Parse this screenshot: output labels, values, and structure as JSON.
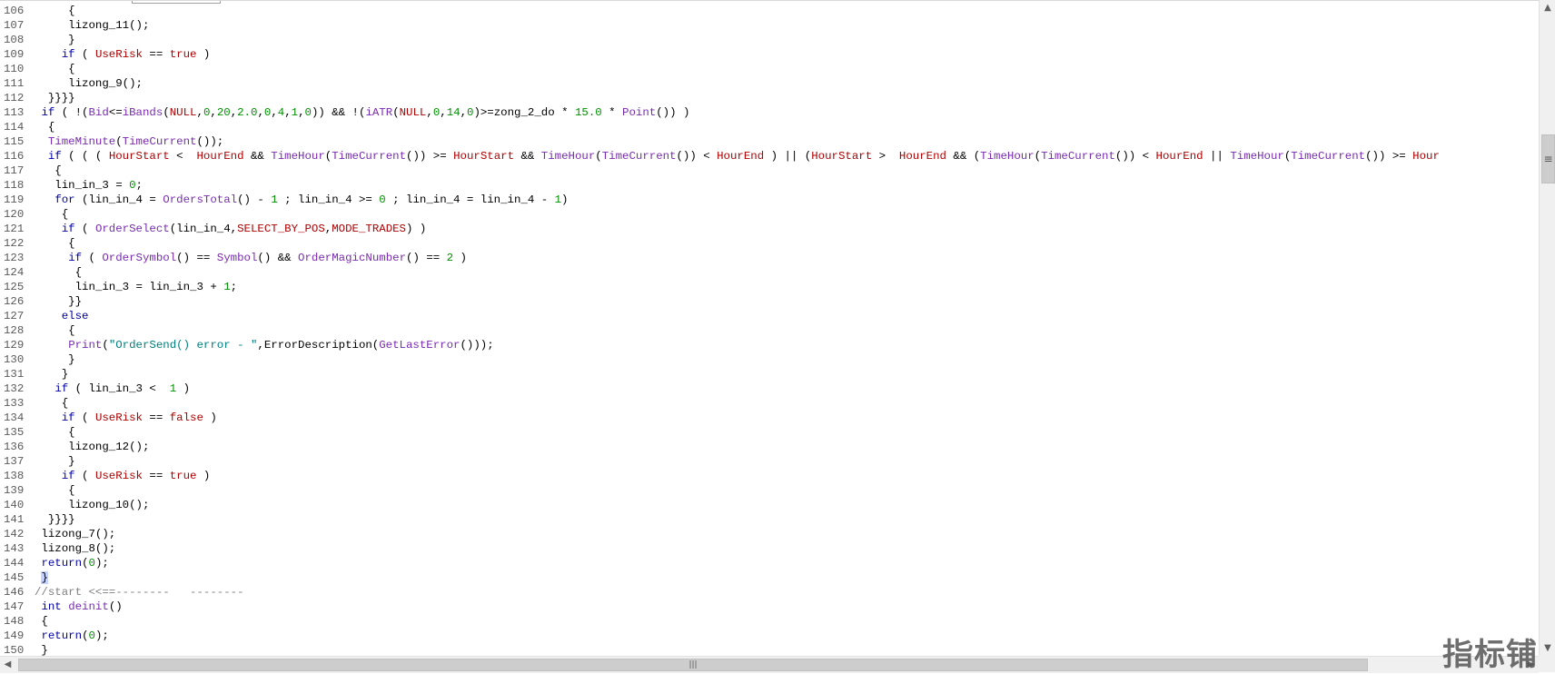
{
  "editor": {
    "lines": [
      {
        "n": "106",
        "t": [
          {
            "s": "     {"
          }
        ]
      },
      {
        "n": "107",
        "t": [
          {
            "s": "     lizong_11();"
          }
        ]
      },
      {
        "n": "108",
        "t": [
          {
            "s": "     }"
          }
        ]
      },
      {
        "n": "109",
        "t": [
          {
            "s": "    "
          },
          {
            "s": "if",
            "c": "k"
          },
          {
            "s": " ( "
          },
          {
            "s": "UseRisk",
            "c": "cst"
          },
          {
            "s": " == "
          },
          {
            "s": "true",
            "c": "cst"
          },
          {
            "s": " )"
          }
        ]
      },
      {
        "n": "110",
        "t": [
          {
            "s": "     {"
          }
        ]
      },
      {
        "n": "111",
        "t": [
          {
            "s": "     lizong_9();"
          }
        ]
      },
      {
        "n": "112",
        "t": [
          {
            "s": "  }}}}"
          }
        ]
      },
      {
        "n": "113",
        "t": [
          {
            "s": " "
          },
          {
            "s": "if",
            "c": "k"
          },
          {
            "s": " ( !("
          },
          {
            "s": "Bid",
            "c": "fn"
          },
          {
            "s": "<="
          },
          {
            "s": "iBands",
            "c": "fn"
          },
          {
            "s": "("
          },
          {
            "s": "NULL",
            "c": "cst"
          },
          {
            "s": ","
          },
          {
            "s": "0",
            "c": "num"
          },
          {
            "s": ","
          },
          {
            "s": "20",
            "c": "num"
          },
          {
            "s": ","
          },
          {
            "s": "2.0",
            "c": "num"
          },
          {
            "s": ","
          },
          {
            "s": "0",
            "c": "num"
          },
          {
            "s": ","
          },
          {
            "s": "4",
            "c": "num"
          },
          {
            "s": ","
          },
          {
            "s": "1",
            "c": "num"
          },
          {
            "s": ","
          },
          {
            "s": "0",
            "c": "num"
          },
          {
            "s": ")) && !("
          },
          {
            "s": "iATR",
            "c": "fn"
          },
          {
            "s": "("
          },
          {
            "s": "NULL",
            "c": "cst"
          },
          {
            "s": ","
          },
          {
            "s": "0",
            "c": "num"
          },
          {
            "s": ","
          },
          {
            "s": "14",
            "c": "num"
          },
          {
            "s": ","
          },
          {
            "s": "0",
            "c": "num"
          },
          {
            "s": ")>=zong_2_do * "
          },
          {
            "s": "15.0",
            "c": "num"
          },
          {
            "s": " * "
          },
          {
            "s": "Point",
            "c": "fn"
          },
          {
            "s": "()) )"
          }
        ]
      },
      {
        "n": "114",
        "t": [
          {
            "s": "  {"
          }
        ]
      },
      {
        "n": "115",
        "t": [
          {
            "s": "  "
          },
          {
            "s": "TimeMinute",
            "c": "fn"
          },
          {
            "s": "("
          },
          {
            "s": "TimeCurrent",
            "c": "fn"
          },
          {
            "s": "());"
          }
        ]
      },
      {
        "n": "116",
        "t": [
          {
            "s": "  "
          },
          {
            "s": "if",
            "c": "k"
          },
          {
            "s": " ( ( ( "
          },
          {
            "s": "HourStart",
            "c": "cst"
          },
          {
            "s": " <  "
          },
          {
            "s": "HourEnd",
            "c": "cst"
          },
          {
            "s": " && "
          },
          {
            "s": "TimeHour",
            "c": "fn"
          },
          {
            "s": "("
          },
          {
            "s": "TimeCurrent",
            "c": "fn"
          },
          {
            "s": "()) >= "
          },
          {
            "s": "HourStart",
            "c": "cst"
          },
          {
            "s": " && "
          },
          {
            "s": "TimeHour",
            "c": "fn"
          },
          {
            "s": "("
          },
          {
            "s": "TimeCurrent",
            "c": "fn"
          },
          {
            "s": "()) < "
          },
          {
            "s": "HourEnd",
            "c": "cst"
          },
          {
            "s": " ) || ("
          },
          {
            "s": "HourStart",
            "c": "cst"
          },
          {
            "s": " >  "
          },
          {
            "s": "HourEnd",
            "c": "cst"
          },
          {
            "s": " && ("
          },
          {
            "s": "TimeHour",
            "c": "fn"
          },
          {
            "s": "("
          },
          {
            "s": "TimeCurrent",
            "c": "fn"
          },
          {
            "s": "()) < "
          },
          {
            "s": "HourEnd",
            "c": "cst"
          },
          {
            "s": " || "
          },
          {
            "s": "TimeHour",
            "c": "fn"
          },
          {
            "s": "("
          },
          {
            "s": "TimeCurrent",
            "c": "fn"
          },
          {
            "s": "()) >= "
          },
          {
            "s": "Hour",
            "c": "cst"
          }
        ]
      },
      {
        "n": "117",
        "t": [
          {
            "s": "   {"
          }
        ]
      },
      {
        "n": "118",
        "t": [
          {
            "s": "   lin_in_3 = "
          },
          {
            "s": "0",
            "c": "num"
          },
          {
            "s": ";"
          }
        ]
      },
      {
        "n": "119",
        "t": [
          {
            "s": "   "
          },
          {
            "s": "for",
            "c": "k"
          },
          {
            "s": " (lin_in_4 = "
          },
          {
            "s": "OrdersTotal",
            "c": "fn"
          },
          {
            "s": "() - "
          },
          {
            "s": "1",
            "c": "num"
          },
          {
            "s": " ; lin_in_4 >= "
          },
          {
            "s": "0",
            "c": "num"
          },
          {
            "s": " ; lin_in_4 = lin_in_4 - "
          },
          {
            "s": "1",
            "c": "num"
          },
          {
            "s": ")"
          }
        ]
      },
      {
        "n": "120",
        "t": [
          {
            "s": "    {"
          }
        ]
      },
      {
        "n": "121",
        "t": [
          {
            "s": "    "
          },
          {
            "s": "if",
            "c": "k"
          },
          {
            "s": " ( "
          },
          {
            "s": "OrderSelect",
            "c": "fn"
          },
          {
            "s": "(lin_in_4,"
          },
          {
            "s": "SELECT_BY_POS",
            "c": "cst"
          },
          {
            "s": ","
          },
          {
            "s": "MODE_TRADES",
            "c": "cst"
          },
          {
            "s": ") )"
          }
        ]
      },
      {
        "n": "122",
        "t": [
          {
            "s": "     {"
          }
        ]
      },
      {
        "n": "123",
        "t": [
          {
            "s": "     "
          },
          {
            "s": "if",
            "c": "k"
          },
          {
            "s": " ( "
          },
          {
            "s": "OrderSymbol",
            "c": "fn"
          },
          {
            "s": "() == "
          },
          {
            "s": "Symbol",
            "c": "fn"
          },
          {
            "s": "() && "
          },
          {
            "s": "OrderMagicNumber",
            "c": "fn"
          },
          {
            "s": "() == "
          },
          {
            "s": "2",
            "c": "num"
          },
          {
            "s": " )"
          }
        ]
      },
      {
        "n": "124",
        "t": [
          {
            "s": "      {"
          }
        ]
      },
      {
        "n": "125",
        "t": [
          {
            "s": "      lin_in_3 = lin_in_3 + "
          },
          {
            "s": "1",
            "c": "num"
          },
          {
            "s": ";"
          }
        ]
      },
      {
        "n": "126",
        "t": [
          {
            "s": "     }}"
          }
        ]
      },
      {
        "n": "127",
        "t": [
          {
            "s": "    "
          },
          {
            "s": "else",
            "c": "k"
          }
        ]
      },
      {
        "n": "128",
        "t": [
          {
            "s": "     {"
          }
        ]
      },
      {
        "n": "129",
        "t": [
          {
            "s": "     "
          },
          {
            "s": "Print",
            "c": "fn"
          },
          {
            "s": "("
          },
          {
            "s": "\"OrderSend() error - \"",
            "c": "str"
          },
          {
            "s": ",ErrorDescription("
          },
          {
            "s": "GetLastError",
            "c": "fn"
          },
          {
            "s": "()));"
          }
        ]
      },
      {
        "n": "130",
        "t": [
          {
            "s": "     }"
          }
        ]
      },
      {
        "n": "131",
        "t": [
          {
            "s": "    }"
          }
        ]
      },
      {
        "n": "132",
        "t": [
          {
            "s": "   "
          },
          {
            "s": "if",
            "c": "k"
          },
          {
            "s": " ( lin_in_3 <  "
          },
          {
            "s": "1",
            "c": "num"
          },
          {
            "s": " )"
          }
        ]
      },
      {
        "n": "133",
        "t": [
          {
            "s": "    {"
          }
        ]
      },
      {
        "n": "134",
        "t": [
          {
            "s": "    "
          },
          {
            "s": "if",
            "c": "k"
          },
          {
            "s": " ( "
          },
          {
            "s": "UseRisk",
            "c": "cst"
          },
          {
            "s": " == "
          },
          {
            "s": "false",
            "c": "cst"
          },
          {
            "s": " )"
          }
        ]
      },
      {
        "n": "135",
        "t": [
          {
            "s": "     {"
          }
        ]
      },
      {
        "n": "136",
        "t": [
          {
            "s": "     lizong_12();"
          }
        ]
      },
      {
        "n": "137",
        "t": [
          {
            "s": "     }"
          }
        ]
      },
      {
        "n": "138",
        "t": [
          {
            "s": "    "
          },
          {
            "s": "if",
            "c": "k"
          },
          {
            "s": " ( "
          },
          {
            "s": "UseRisk",
            "c": "cst"
          },
          {
            "s": " == "
          },
          {
            "s": "true",
            "c": "cst"
          },
          {
            "s": " )"
          }
        ]
      },
      {
        "n": "139",
        "t": [
          {
            "s": "     {"
          }
        ]
      },
      {
        "n": "140",
        "t": [
          {
            "s": "     lizong_10();"
          }
        ]
      },
      {
        "n": "141",
        "t": [
          {
            "s": "  }}}}"
          }
        ]
      },
      {
        "n": "142",
        "t": [
          {
            "s": " lizong_7();"
          }
        ]
      },
      {
        "n": "143",
        "t": [
          {
            "s": " lizong_8();"
          }
        ]
      },
      {
        "n": "144",
        "t": [
          {
            "s": " "
          },
          {
            "s": "return",
            "c": "k"
          },
          {
            "s": "("
          },
          {
            "s": "0",
            "c": "num"
          },
          {
            "s": ");"
          }
        ]
      },
      {
        "n": "145",
        "t": [
          {
            "s": " "
          },
          {
            "s": "}",
            "c": "sel"
          }
        ]
      },
      {
        "n": "146",
        "t": [
          {
            "s": "//start <<==--------   --------",
            "c": "cm"
          }
        ]
      },
      {
        "n": "147",
        "t": [
          {
            "s": " "
          },
          {
            "s": "int",
            "c": "k"
          },
          {
            "s": " "
          },
          {
            "s": "deinit",
            "c": "fn"
          },
          {
            "s": "()"
          }
        ]
      },
      {
        "n": "148",
        "t": [
          {
            "s": " {"
          }
        ]
      },
      {
        "n": "149",
        "t": [
          {
            "s": " "
          },
          {
            "s": "return",
            "c": "k"
          },
          {
            "s": "("
          },
          {
            "s": "0",
            "c": "num"
          },
          {
            "s": ");"
          }
        ]
      },
      {
        "n": "150",
        "t": [
          {
            "s": " }"
          }
        ]
      }
    ]
  },
  "scrollbars": {
    "up_arrow": "▲",
    "down_arrow": "▼",
    "left_arrow": "◀",
    "right_arrow": "▶",
    "vertical_grip": "≡",
    "horizontal_grip": "|||"
  },
  "watermark": {
    "text": "指标铺"
  }
}
